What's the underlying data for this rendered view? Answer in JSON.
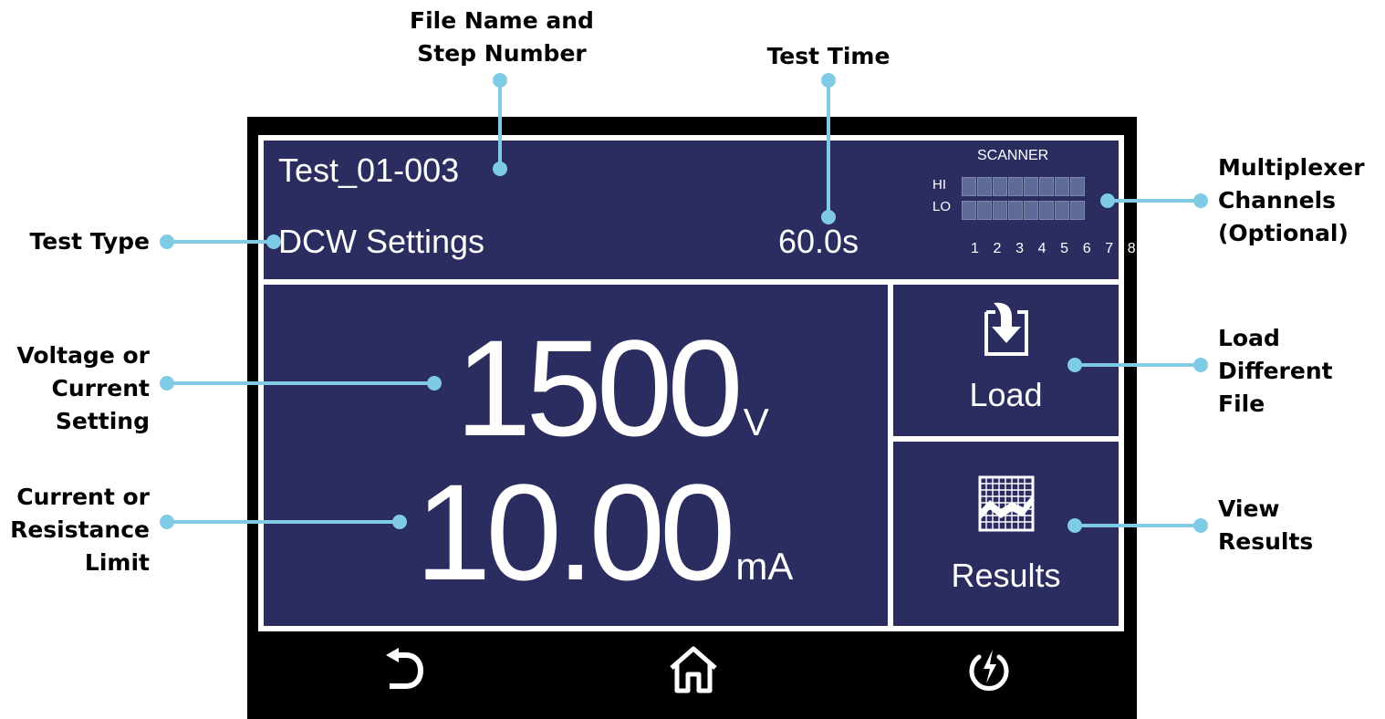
{
  "annotations": {
    "file_name_step": [
      "File Name and",
      "Step Number"
    ],
    "test_time": [
      "Test Time"
    ],
    "multiplexer": [
      "Multiplexer",
      "Channels",
      "(Optional)"
    ],
    "test_type": [
      "Test Type"
    ],
    "voltage_current": [
      "Voltage or",
      "Current",
      "Setting"
    ],
    "current_resistance": [
      "Current or",
      "Resistance",
      "Limit"
    ],
    "load_file": [
      "Load",
      "Different",
      "File"
    ],
    "view_results": [
      "View",
      "Results"
    ]
  },
  "screen": {
    "file_name": "Test_01-003",
    "test_type": "DCW Settings",
    "test_time": "60.0s",
    "scanner": {
      "title": "SCANNER",
      "hi_label": "HI",
      "lo_label": "LO",
      "channels": "1 2 3 4 5 6 7 8"
    },
    "voltage": {
      "value": "1500",
      "unit": "V"
    },
    "limit": {
      "value": "10.00",
      "unit": "mA"
    },
    "load_label": "Load",
    "results_label": "Results"
  },
  "icons": {
    "load": "load-file-icon",
    "results": "results-chart-icon",
    "back": "back-arrow-icon",
    "home": "home-icon",
    "power": "power-icon"
  },
  "colors": {
    "panel": "#2b2d60",
    "leader": "#7fcbe6",
    "bezel": "#000000"
  }
}
